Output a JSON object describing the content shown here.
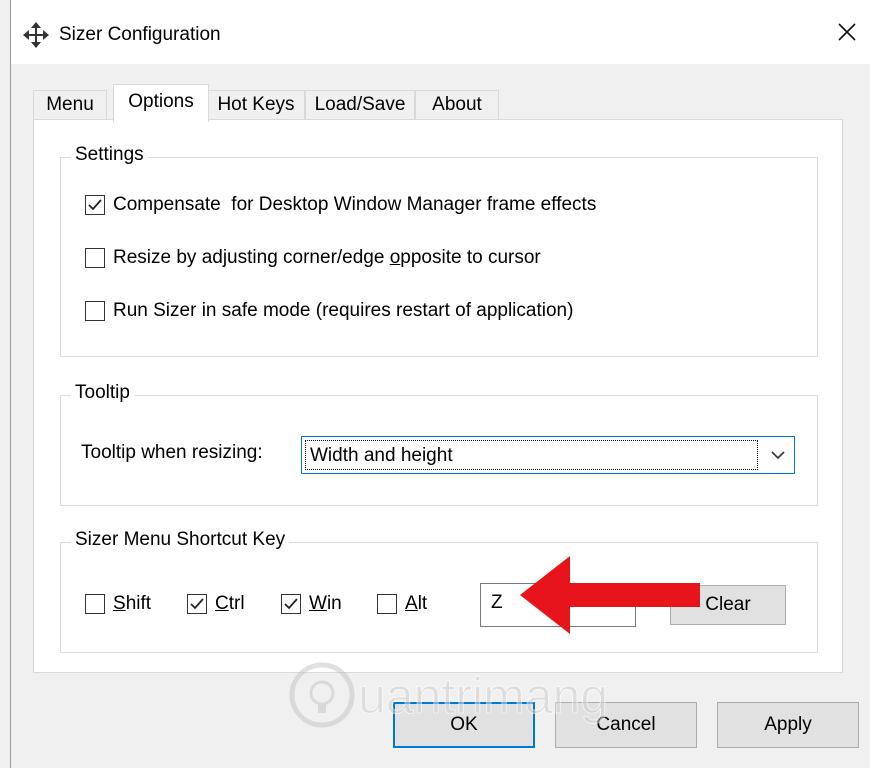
{
  "window": {
    "title": "Sizer Configuration",
    "close_glyph": "✕",
    "icon": "move-arrows-icon"
  },
  "tabs": [
    "Menu",
    "Options",
    "Hot Keys",
    "Load/Save",
    "About"
  ],
  "active_tab": "Options",
  "settings": {
    "title": "Settings",
    "options": [
      {
        "label": "Compensate  for Desktop Window Manager frame effects",
        "checked": true
      },
      {
        "label_pre": "Resize by adjusting corner/edge ",
        "label_u": "o",
        "label_post": "pposite to cursor",
        "checked": false
      },
      {
        "label": "Run Sizer in safe mode (requires restart of application)",
        "checked": false
      }
    ]
  },
  "tooltip": {
    "title": "Tooltip",
    "label": "Tooltip when resizing:",
    "selected": "Width and height"
  },
  "shortcut": {
    "title": "Sizer Menu Shortcut Key",
    "modifiers": [
      {
        "u": "S",
        "rest": "hift",
        "checked": false
      },
      {
        "u": "C",
        "rest": "trl",
        "checked": true
      },
      {
        "u": "W",
        "rest": "in",
        "checked": true
      },
      {
        "u": "A",
        "rest": "lt",
        "checked": false
      }
    ],
    "key": "Z",
    "clear_label": "Clear"
  },
  "buttons": {
    "ok": "OK",
    "cancel": "Cancel",
    "apply": "Apply"
  },
  "annotation": {
    "arrow_color": "#e8141b"
  },
  "watermark": {
    "text": "uantrimang"
  },
  "colors": {
    "accent": "#0078d7",
    "panel": "#ffffff",
    "chrome": "#f0f0f0"
  }
}
